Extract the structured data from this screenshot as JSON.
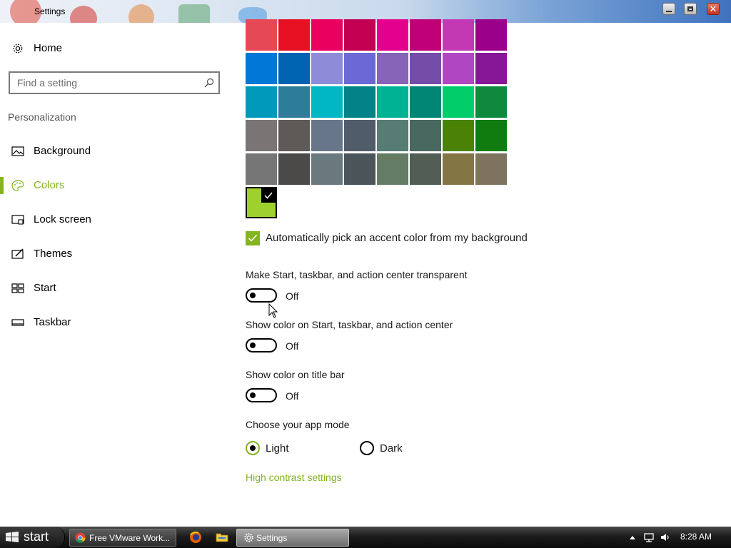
{
  "window": {
    "title": "Settings"
  },
  "sidebar": {
    "home_label": "Home",
    "search_placeholder": "Find a setting",
    "section_heading": "Personalization",
    "items": [
      {
        "label": "Background",
        "icon": "picture-icon",
        "active": false
      },
      {
        "label": "Colors",
        "icon": "palette-icon",
        "active": true
      },
      {
        "label": "Lock screen",
        "icon": "lock-screen-icon",
        "active": false
      },
      {
        "label": "Themes",
        "icon": "themes-icon",
        "active": false
      },
      {
        "label": "Start",
        "icon": "start-tiles-icon",
        "active": false
      },
      {
        "label": "Taskbar",
        "icon": "taskbar-icon",
        "active": false
      }
    ]
  },
  "colors": {
    "swatches": [
      "#e74856",
      "#e81123",
      "#ea005e",
      "#c30052",
      "#e3008c",
      "#bf0077",
      "#c239b3",
      "#9a0089",
      "#0078d7",
      "#0063b1",
      "#8e8cd8",
      "#6b69d6",
      "#8764b8",
      "#744da9",
      "#b146c2",
      "#881798",
      "#0099bc",
      "#2d7d9a",
      "#00b7c3",
      "#038387",
      "#00b294",
      "#018574",
      "#00cc6a",
      "#10893e",
      "#7a7574",
      "#5d5a58",
      "#68768a",
      "#515c6b",
      "#567c73",
      "#486860",
      "#498205",
      "#107c10",
      "#767676",
      "#4c4a48",
      "#69797e",
      "#4a5459",
      "#647c64",
      "#525e54",
      "#847545",
      "#7e735f"
    ],
    "selected_color": "#9fd12e",
    "accent_color": "#84b41f",
    "auto_pick_label": "Automatically pick an accent color from my background",
    "auto_pick_checked": true
  },
  "toggles": [
    {
      "label": "Make Start, taskbar, and action center transparent",
      "state": "Off"
    },
    {
      "label": "Show color on Start, taskbar, and action center",
      "state": "Off"
    },
    {
      "label": "Show color on title bar",
      "state": "Off"
    }
  ],
  "app_mode": {
    "heading": "Choose your app mode",
    "options": [
      {
        "label": "Light",
        "selected": true
      },
      {
        "label": "Dark",
        "selected": false
      }
    ]
  },
  "high_contrast_link": "High contrast settings",
  "taskbar": {
    "start_label": "start",
    "tasks": [
      {
        "label": "Free VMware Work...",
        "icon": "chrome-icon",
        "active": false
      },
      {
        "label": "Settings",
        "icon": "gear-icon",
        "active": true
      }
    ],
    "quick_launch": [
      "firefox-icon",
      "folder-icon"
    ],
    "tray_icons": [
      "chevron-up-icon",
      "network-icon",
      "volume-icon"
    ],
    "clock": "8:28 AM"
  }
}
